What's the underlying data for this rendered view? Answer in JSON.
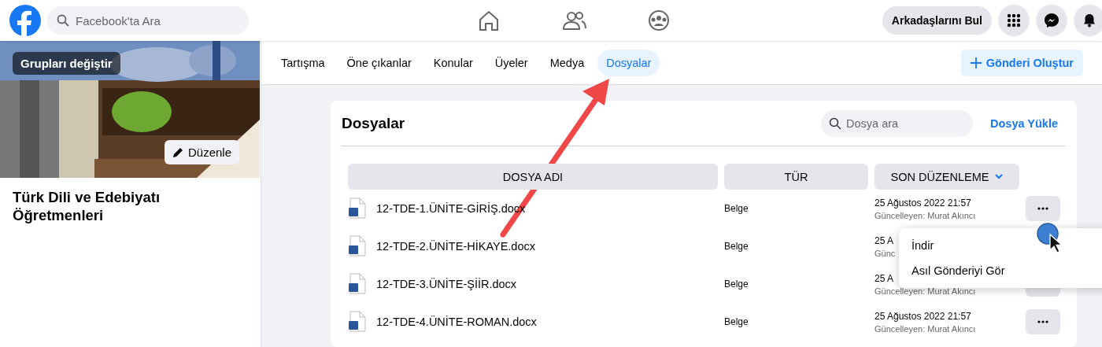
{
  "topbar": {
    "search": {
      "placeholder": "Facebook'ta Ara"
    },
    "find_friends": "Arkadaşlarını Bul"
  },
  "group": {
    "switch_button": "Grupları değiştir",
    "edit_button": "Düzenle",
    "name": "Türk Dili ve Edebiyatı Öğretmenleri"
  },
  "tabs": [
    {
      "label": "Tartışma",
      "selected": false
    },
    {
      "label": "Öne çıkanlar",
      "selected": false
    },
    {
      "label": "Konular",
      "selected": false
    },
    {
      "label": "Üyeler",
      "selected": false
    },
    {
      "label": "Medya",
      "selected": false
    },
    {
      "label": "Dosyalar",
      "selected": true
    }
  ],
  "create_post": "Gönderi Oluştur",
  "files": {
    "title": "Dosyalar",
    "search": {
      "placeholder": "Dosya ara"
    },
    "upload": "Dosya Yükle",
    "columns": [
      "DOSYA ADI",
      "TÜR",
      "SON DÜZENLEME"
    ],
    "rows": [
      {
        "name": "12-TDE-1.ÜNİTE-GİRİŞ.docx",
        "type": "Belge",
        "date": "25 Ağustos 2022 21:57",
        "updated_by": "Güncelleyen: Murat Akıncı",
        "menu_button": true
      },
      {
        "name": "12-TDE-2.ÜNİTE-HİKAYE.docx",
        "type": "Belge",
        "date": "25 A",
        "updated_by": "Günc",
        "menu_button": false
      },
      {
        "name": "12-TDE-3.ÜNİTE-ŞİİR.docx",
        "type": "Belge",
        "date": "25 A",
        "updated_by": "Güncelleyen: Murat Akıncı",
        "menu_button": true
      },
      {
        "name": "12-TDE-4.ÜNİTE-ROMAN.docx",
        "type": "Belge",
        "date": "25 Ağustos 2022 21:57",
        "updated_by": "Güncelleyen: Murat Akıncı",
        "menu_button": true
      }
    ]
  },
  "context_menu": [
    "İndir",
    "Asıl Gönderiyi Gör"
  ]
}
